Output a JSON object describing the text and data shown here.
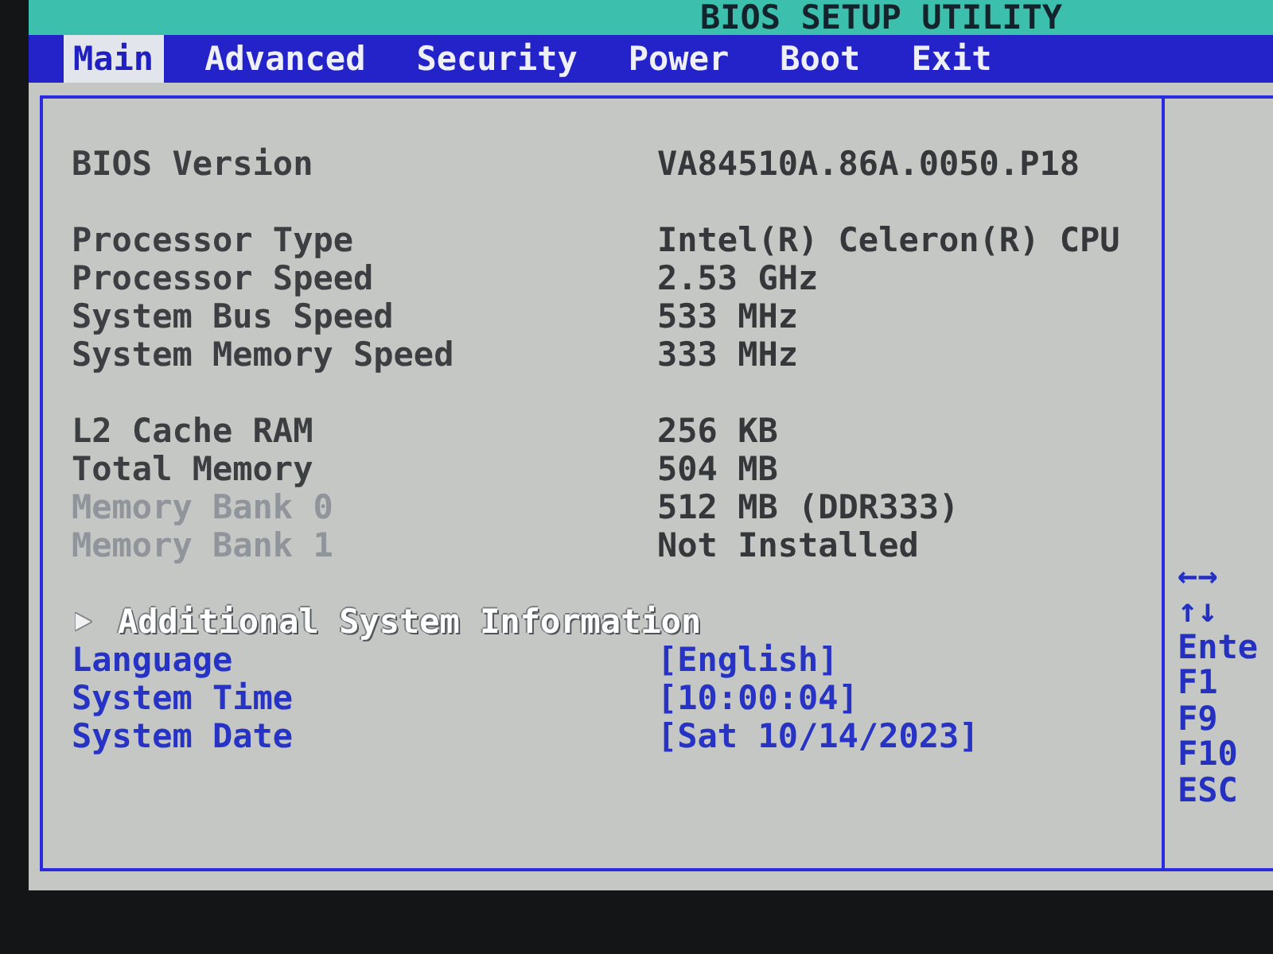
{
  "window": {
    "title": "BIOS SETUP UTILITY"
  },
  "tabs": [
    {
      "label": "Main",
      "selected": true
    },
    {
      "label": "Advanced",
      "selected": false
    },
    {
      "label": "Security",
      "selected": false
    },
    {
      "label": "Power",
      "selected": false
    },
    {
      "label": "Boot",
      "selected": false
    },
    {
      "label": "Exit",
      "selected": false
    }
  ],
  "main_panel": {
    "sections": [
      {
        "items": [
          {
            "kind": "info",
            "label": "BIOS Version",
            "value": "VA84510A.86A.0050.P18",
            "disabled": false
          }
        ]
      },
      {
        "items": [
          {
            "kind": "info",
            "label": "Processor Type",
            "value": "Intel(R) Celeron(R) CPU",
            "disabled": false
          },
          {
            "kind": "info",
            "label": "Processor Speed",
            "value": "2.53 GHz",
            "disabled": false
          },
          {
            "kind": "info",
            "label": "System Bus Speed",
            "value": "533 MHz",
            "disabled": false
          },
          {
            "kind": "info",
            "label": "System Memory Speed",
            "value": "333 MHz",
            "disabled": false
          }
        ]
      },
      {
        "items": [
          {
            "kind": "info",
            "label": "L2 Cache RAM",
            "value": "256 KB",
            "disabled": false
          },
          {
            "kind": "info",
            "label": "Total Memory",
            "value": "504 MB",
            "disabled": false
          },
          {
            "kind": "info",
            "label": "Memory Bank 0",
            "value": "512 MB (DDR333)",
            "disabled": true
          },
          {
            "kind": "info",
            "label": "Memory Bank 1",
            "value": "Not Installed",
            "disabled": true
          }
        ]
      },
      {
        "items": [
          {
            "kind": "submenu",
            "label": "Additional System Information",
            "disabled": false
          },
          {
            "kind": "setting",
            "label": "Language",
            "value": "[English]",
            "disabled": false
          },
          {
            "kind": "setting",
            "label": "System Time",
            "value": "[10:00:04]",
            "disabled": false
          },
          {
            "kind": "setting",
            "label": "System Date",
            "value": "[Sat 10/14/2023]",
            "disabled": false
          }
        ]
      }
    ]
  },
  "help_panel": {
    "keys": [
      "←→",
      "↑↓",
      "Ente",
      "F1",
      "F9",
      "F10",
      "ESC"
    ]
  }
}
